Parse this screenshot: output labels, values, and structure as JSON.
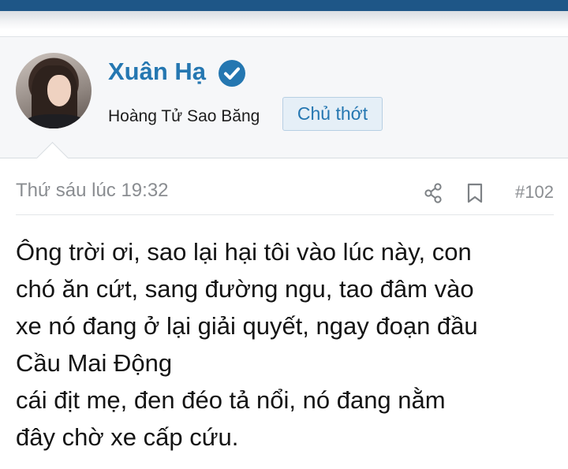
{
  "user": {
    "name": "Xuân Hạ",
    "title": "Hoàng Tử Sao Băng",
    "badge": "Chủ thớt",
    "verified_color": "#2577b1"
  },
  "post": {
    "date": "Thứ sáu lúc 19:32",
    "number": "#102",
    "icons": [
      "share-icon",
      "bookmark-icon"
    ],
    "lines": [
      "Ông trời ơi, sao lại hại tôi vào lúc này, con",
      "chó ăn cứt, sang đường ngu, tao đâm vào",
      "xe nó đang ở lại giải quyết, ngay đoạn đầu",
      "Cầu Mai Động",
      "cái địt mẹ, đen đéo tả nổi, nó đang nằm",
      "đây chờ xe cấp cứu."
    ]
  },
  "colors": {
    "header_bar": "#1e5687",
    "accent": "#2577b1",
    "badge_bg": "#e5eff7"
  }
}
